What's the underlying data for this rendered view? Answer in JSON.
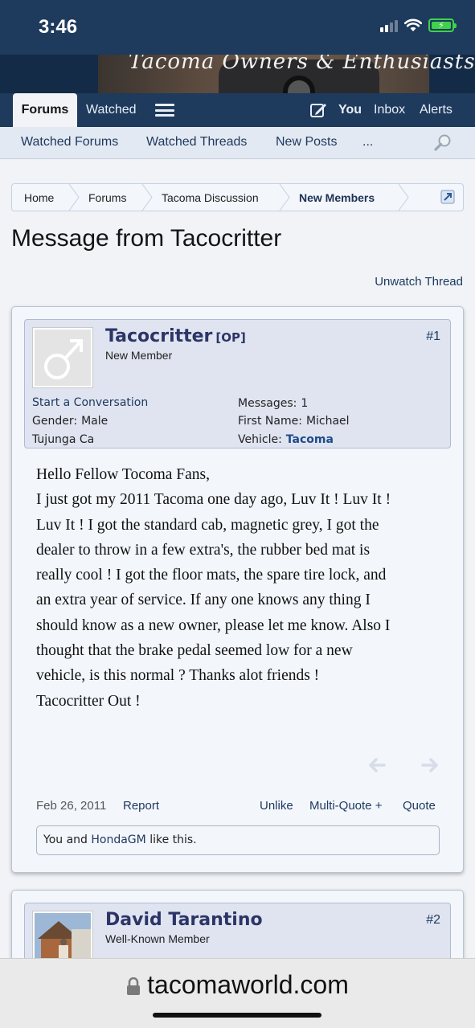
{
  "status_bar": {
    "time": "3:46"
  },
  "banner": {
    "logo_text": "Tacoma Owners & Enthusiasts"
  },
  "nav": {
    "tabs": [
      "Forums",
      "Watched"
    ],
    "right": {
      "you": "You",
      "inbox": "Inbox",
      "alerts": "Alerts"
    }
  },
  "subnav": {
    "links": [
      "Watched Forums",
      "Watched Threads",
      "New Posts",
      "..."
    ]
  },
  "breadcrumb": [
    "Home",
    "Forums",
    "Tacoma Discussion",
    "New Members"
  ],
  "page": {
    "title": "Message from Tacocritter",
    "unwatch": "Unwatch Thread"
  },
  "posts": [
    {
      "username": "Tacocritter",
      "op_badge": "[OP]",
      "user_title": "New Member",
      "post_number": "#1",
      "start_conversation": "Start a Conversation",
      "gender_label": "Gender:",
      "gender": "Male",
      "location": "Tujunga Ca",
      "messages_label": "Messages:",
      "messages": "1",
      "first_name_label": "First Name:",
      "first_name": "Michael",
      "vehicle_label": "Vehicle:",
      "vehicle": "Tacoma",
      "message_lines": [
        "Hello Fellow Tocoma Fans,",
        "I just got my 2011 Tacoma one day ago, Luv It ! Luv It !",
        "Luv It ! I got the standard cab, magnetic grey, I got the",
        "dealer to throw in a few extra's, the rubber bed mat is",
        "really cool ! I got the floor mats, the spare tire lock, and",
        "an extra year of service. If any one knows any thing I",
        "should know as a new owner, please let me know. Also I",
        "thought that the brake pedal seemed low for a new",
        "vehicle, is this normal ? Thanks alot friends !",
        "Tacocritter Out !"
      ],
      "date": "Feb 26, 2011",
      "report": "Report",
      "unlike": "Unlike",
      "multi_quote": "Multi-Quote +",
      "quote": "Quote",
      "likes": {
        "prefix": "You and",
        "liker": "HondaGM",
        "suffix": "like this."
      }
    },
    {
      "username": "David Tarantino",
      "user_title": "Well-Known Member",
      "post_number": "#2"
    }
  ],
  "url_bar": {
    "domain": "tacomaworld.com"
  },
  "colors": {
    "header_bg": "#1e3a5c",
    "link": "#1f3a60",
    "username": "#2c3566",
    "battery": "#3fd24b"
  }
}
